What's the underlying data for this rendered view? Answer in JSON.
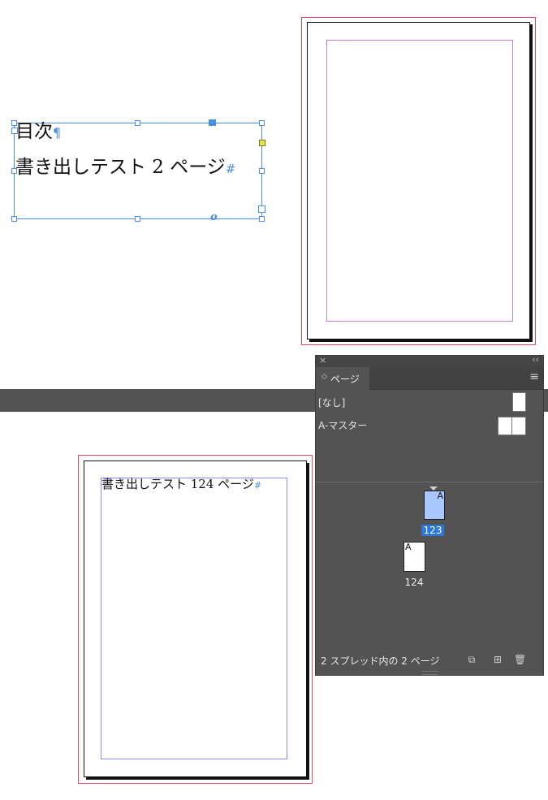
{
  "canvas": {
    "text_frame": {
      "heading": "目次",
      "entry": "書き出しテスト 2 ページ",
      "pilcrow": "¶",
      "end_mark": "#",
      "overset_glyph": "o"
    },
    "bottom_page": {
      "text": "書き出しテスト 124 ページ",
      "end_mark": "#"
    }
  },
  "pages_panel": {
    "collapse_glyph": "‹‹",
    "close_glyph": "×",
    "tab_label": "ページ",
    "tab_icon": "◇",
    "menu_icon": "≡",
    "masters": [
      {
        "label": "[なし]"
      },
      {
        "label": "A-マスター"
      }
    ],
    "pages": [
      {
        "number": "123",
        "master_prefix": "A",
        "selected": true
      },
      {
        "number": "124",
        "master_prefix": "A",
        "selected": false
      }
    ],
    "status_text": "2 スプレッド内の 2 ページ",
    "footer_icons": [
      "edit-page-size-icon",
      "new-page-icon",
      "trash-icon"
    ]
  }
}
